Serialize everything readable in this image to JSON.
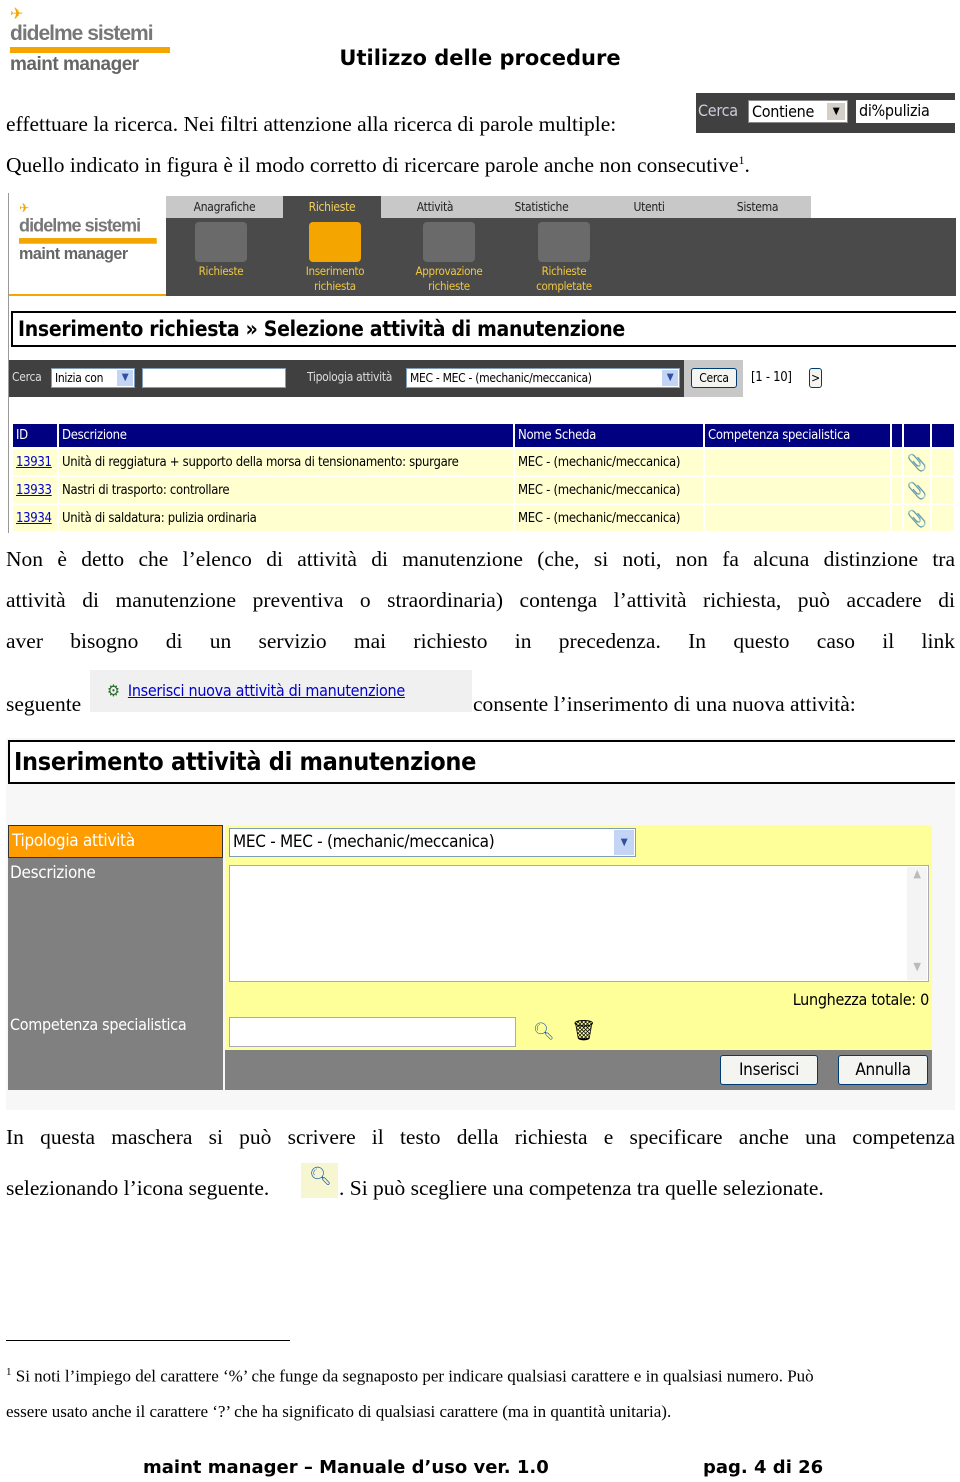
{
  "header": {
    "logo_line1": "didelme sistemi",
    "logo_group": "GROUP",
    "logo_line2": "maint manager",
    "title": "Utilizzo delle procedure"
  },
  "intro": {
    "line1": "effettuare la ricerca. Nei filtri attenzione alla ricerca di parole multiple:",
    "line2": "Quello indicato in figura è il modo corretto di ricercare parole anche non consecutive",
    "footnote_ref": "1",
    "line2_end": "."
  },
  "search_example": {
    "label": "Cerca",
    "mode": "Contiene",
    "value": "di%pulizia"
  },
  "screen1": {
    "tabs": [
      "Anagrafiche",
      "Richieste",
      "Attività",
      "Statistiche",
      "Utenti",
      "Sistema"
    ],
    "active_tab": "Richieste",
    "nav": [
      {
        "line1": "Richieste",
        "line2": ""
      },
      {
        "line1": "Inserimento",
        "line2": "richiesta"
      },
      {
        "line1": "Approvazione",
        "line2": "richieste"
      },
      {
        "line1": "Richieste",
        "line2": "completate"
      }
    ],
    "page_title": "Inserimento richiesta » Selezione attività di manutenzione",
    "filter": {
      "cerca_label": "Cerca",
      "mode": "Inizia con",
      "value": "",
      "tipologia_label": "Tipologia attività",
      "tipologia_value": "MEC - MEC - (mechanic/meccanica)",
      "search_button": "Cerca",
      "range": "[1 - 10]",
      "next": ">"
    },
    "columns": [
      "ID",
      "Descrizione",
      "Nome Scheda",
      "Competenza specialistica",
      "",
      ""
    ],
    "rows": [
      {
        "id": "13931",
        "descrizione": "Unità di reggiatura + supporto della morsa di tensionamento: spurgare",
        "scheda": "MEC - (mechanic/meccanica)",
        "competenza": "",
        "icon": "paperclip-icon"
      },
      {
        "id": "13933",
        "descrizione": "Nastri di trasporto: controllare",
        "scheda": "MEC - (mechanic/meccanica)",
        "competenza": "",
        "icon": "paperclip-document-icon"
      },
      {
        "id": "13934",
        "descrizione": "Unità di saldatura: pulizia ordinaria",
        "scheda": "MEC - (mechanic/meccanica)",
        "competenza": "",
        "icon": "paperclip-icon"
      }
    ],
    "colors": {
      "nav_bg": "#4a4a4a",
      "table_header": "#000080",
      "row_bg": "#ffffd0",
      "accent": "#f5a500"
    }
  },
  "para1": {
    "line1": "Non è detto che l’elenco di attività di manutenzione (che, si noti, non fa alcuna distinzione tra",
    "line2": "attività di manutenzione preventiva o straordinaria) contenga l’attività richiesta, può accadere di",
    "line3": "aver bisogno di un servizio mai richiesto in precedenza. In questo caso il link",
    "line4_start": "seguente",
    "link": "Inserisci nuova attività di manutenzione",
    "line4_end": "consente l’inserimento di una nuova attività:"
  },
  "screen2": {
    "title": "Inserimento attività di manutenzione",
    "tipologia_label": "Tipologia attività",
    "tipologia_value": "MEC - MEC - (mechanic/meccanica)",
    "descrizione_label": "Descrizione",
    "descrizione_value": "",
    "lunghezza": "Lunghezza totale: 0",
    "competenza_label": "Competenza specialistica",
    "competenza_value": "",
    "insert_button": "Inserisci",
    "cancel_button": "Annulla",
    "colors": {
      "label_bg": "#808080",
      "label_active": "#ff9c00",
      "field_bg": "#ffff99"
    }
  },
  "para2": {
    "line1": "In questa maschera si può scrivere il testo della richiesta e specificare anche una competenza",
    "line2_start": "selezionando l’icona seguente.",
    "line2_end": ". Si può scegliere una competenza tra quelle selezionate."
  },
  "footnote": {
    "number": "1",
    "line1": "Si noti l’impiego del carattere ‘%’ che funge da segnaposto per indicare qualsiasi carattere e in qualsiasi numero. Può",
    "line2": "essere usato anche il carattere ‘?’ che ha significato di qualsiasi carattere (ma in quantità unitaria)."
  },
  "footer": {
    "left": "maint manager – Manuale d’uso ver. 1.0",
    "right": "pag. 4 di 26"
  }
}
